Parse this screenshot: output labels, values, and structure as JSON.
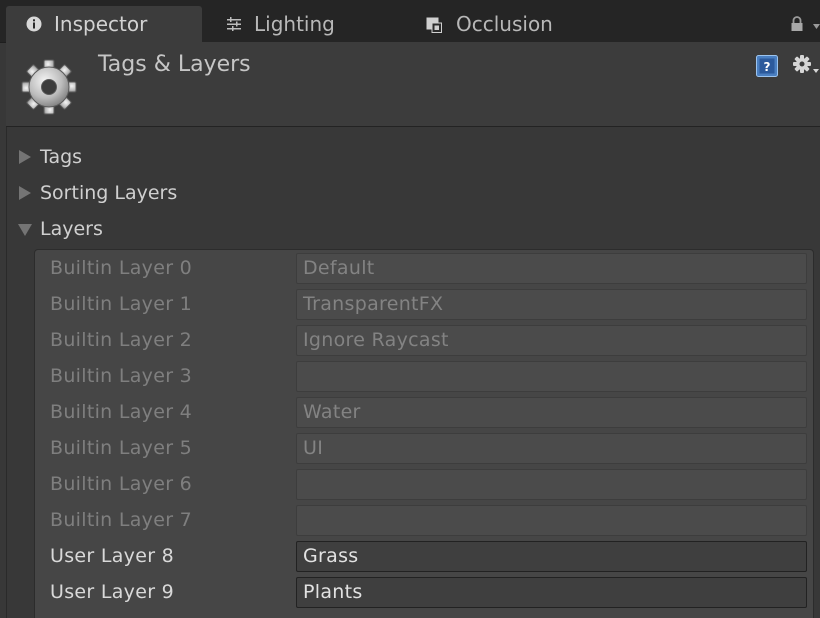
{
  "tabs": [
    {
      "label": "Inspector",
      "icon": "info-icon",
      "active": true
    },
    {
      "label": "Lighting",
      "icon": "lighting-icon",
      "active": false
    },
    {
      "label": "Occlusion",
      "icon": "occlusion-icon",
      "active": false
    }
  ],
  "header": {
    "title": "Tags & Layers",
    "icon": "gear-icon"
  },
  "sections": {
    "tags": {
      "label": "Tags",
      "expanded": false
    },
    "sorting_layers": {
      "label": "Sorting Layers",
      "expanded": false
    },
    "layers": {
      "label": "Layers",
      "expanded": true
    }
  },
  "layers": [
    {
      "label": "Builtin Layer 0",
      "value": "Default",
      "editable": false
    },
    {
      "label": "Builtin Layer 1",
      "value": "TransparentFX",
      "editable": false
    },
    {
      "label": "Builtin Layer 2",
      "value": "Ignore Raycast",
      "editable": false
    },
    {
      "label": "Builtin Layer 3",
      "value": "",
      "editable": false
    },
    {
      "label": "Builtin Layer 4",
      "value": "Water",
      "editable": false
    },
    {
      "label": "Builtin Layer 5",
      "value": "UI",
      "editable": false
    },
    {
      "label": "Builtin Layer 6",
      "value": "",
      "editable": false
    },
    {
      "label": "Builtin Layer 7",
      "value": "",
      "editable": false
    },
    {
      "label": "User Layer 8",
      "value": "Grass",
      "editable": true
    },
    {
      "label": "User Layer 9",
      "value": "Plants",
      "editable": true
    }
  ],
  "colors": {
    "background": "#383838",
    "tab_bar": "#252525",
    "text": "#d0d0d0",
    "disabled_text": "#7f7f7f"
  }
}
